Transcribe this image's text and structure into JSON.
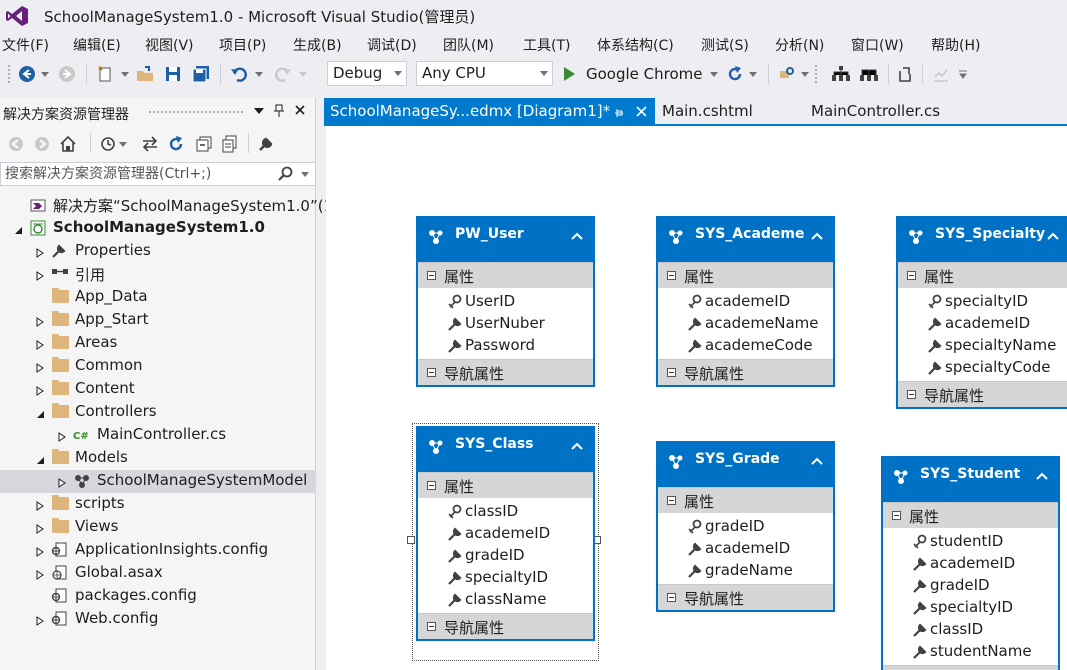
{
  "window": {
    "title": "SchoolManageSystem1.0 - Microsoft Visual Studio(管理员)"
  },
  "menu": [
    "文件(F)",
    "编辑(E)",
    "视图(V)",
    "项目(P)",
    "生成(B)",
    "调试(D)",
    "团队(M)",
    "工具(T)",
    "体系结构(C)",
    "测试(S)",
    "分析(N)",
    "窗口(W)",
    "帮助(H)"
  ],
  "toolbar": {
    "configuration": "Debug",
    "platform": "Any CPU",
    "run_target": "Google Chrome"
  },
  "solution_explorer": {
    "title": "解决方案资源管理器",
    "search_placeholder": "搜索解决方案资源管理器(Ctrl+;)",
    "items": [
      {
        "label": "解决方案“SchoolManageSystem1.0”(1 -",
        "icon": "solution-icon",
        "expander": "none"
      },
      {
        "label": "SchoolManageSystem1.0",
        "icon": "web-project-icon",
        "expander": "expanded",
        "bold": true
      },
      {
        "label": "Properties",
        "icon": "wrench-icon",
        "expander": "collapsed"
      },
      {
        "label": "引用",
        "icon": "references-icon",
        "expander": "collapsed"
      },
      {
        "label": "App_Data",
        "icon": "folder-icon",
        "expander": "none"
      },
      {
        "label": "App_Start",
        "icon": "folder-icon",
        "expander": "collapsed"
      },
      {
        "label": "Areas",
        "icon": "folder-icon",
        "expander": "collapsed"
      },
      {
        "label": "Common",
        "icon": "folder-icon",
        "expander": "collapsed"
      },
      {
        "label": "Content",
        "icon": "folder-icon",
        "expander": "collapsed"
      },
      {
        "label": "Controllers",
        "icon": "folder-open-icon",
        "expander": "expanded"
      },
      {
        "label": "MainController.cs",
        "icon": "csharp-file-icon",
        "expander": "collapsed"
      },
      {
        "label": "Models",
        "icon": "folder-open-icon",
        "expander": "expanded"
      },
      {
        "label": "SchoolManageSystemModel",
        "icon": "edmx-icon",
        "expander": "collapsed",
        "selected": true
      },
      {
        "label": "scripts",
        "icon": "folder-icon",
        "expander": "collapsed"
      },
      {
        "label": "Views",
        "icon": "folder-icon",
        "expander": "collapsed"
      },
      {
        "label": "ApplicationInsights.config",
        "icon": "config-file-icon",
        "expander": "collapsed"
      },
      {
        "label": "Global.asax",
        "icon": "asax-file-icon",
        "expander": "collapsed"
      },
      {
        "label": "packages.config",
        "icon": "config-file-icon",
        "expander": "none"
      },
      {
        "label": "Web.config",
        "icon": "config-file-icon",
        "expander": "collapsed"
      }
    ]
  },
  "tabs": [
    {
      "label": "SchoolManageSy...edmx [Diagram1]*",
      "active": true
    },
    {
      "label": "Main.cshtml",
      "active": false
    },
    {
      "label": "MainController.cs",
      "active": false
    }
  ],
  "diagram": {
    "section_props": "属性",
    "section_nav": "导航属性",
    "entities": [
      {
        "name": "PW_User",
        "properties": [
          {
            "name": "UserID",
            "key": true
          },
          {
            "name": "UserNuber",
            "key": false
          },
          {
            "name": "Password",
            "key": false
          }
        ]
      },
      {
        "name": "SYS_Academe",
        "properties": [
          {
            "name": "academeID",
            "key": true
          },
          {
            "name": "academeName",
            "key": false
          },
          {
            "name": "academeCode",
            "key": false
          }
        ]
      },
      {
        "name": "SYS_Specialty",
        "properties": [
          {
            "name": "specialtyID",
            "key": true
          },
          {
            "name": "academeID",
            "key": false
          },
          {
            "name": "specialtyName",
            "key": false
          },
          {
            "name": "specialtyCode",
            "key": false
          }
        ]
      },
      {
        "name": "SYS_Class",
        "selected": true,
        "properties": [
          {
            "name": "classID",
            "key": true
          },
          {
            "name": "academeID",
            "key": false
          },
          {
            "name": "gradeID",
            "key": false
          },
          {
            "name": "specialtyID",
            "key": false
          },
          {
            "name": "className",
            "key": false
          }
        ]
      },
      {
        "name": "SYS_Grade",
        "properties": [
          {
            "name": "gradeID",
            "key": true
          },
          {
            "name": "academeID",
            "key": false
          },
          {
            "name": "gradeName",
            "key": false
          }
        ]
      },
      {
        "name": "SYS_Student",
        "properties": [
          {
            "name": "studentID",
            "key": true
          },
          {
            "name": "academeID",
            "key": false
          },
          {
            "name": "gradeID",
            "key": false
          },
          {
            "name": "specialtyID",
            "key": false
          },
          {
            "name": "classID",
            "key": false
          },
          {
            "name": "studentName",
            "key": false
          }
        ]
      }
    ]
  },
  "colors": {
    "accent": "#007acc",
    "entity_header": "#0072c6",
    "section_bg": "#d6d6d6",
    "run_green": "#388a34"
  }
}
